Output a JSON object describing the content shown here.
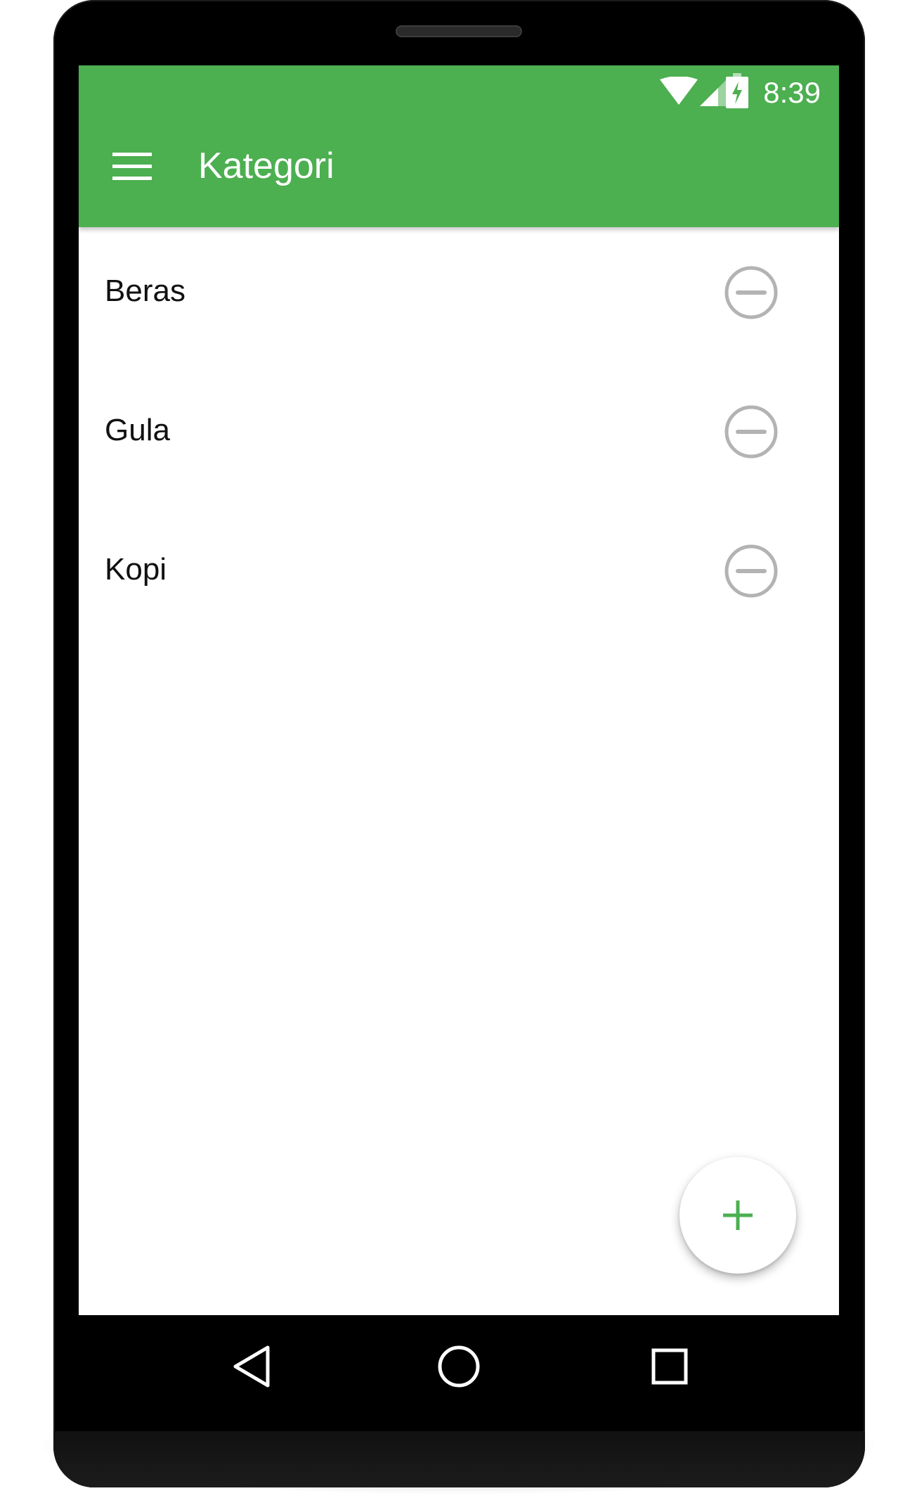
{
  "status_bar": {
    "time": "8:39",
    "icons": [
      "wifi-icon",
      "cell-signal-icon",
      "battery-charging-icon"
    ]
  },
  "app_bar": {
    "menu_icon": "hamburger-menu-icon",
    "title": "Kategori",
    "color": "#4caf50"
  },
  "categories": [
    {
      "label": "Beras",
      "action_icon": "remove-circle-icon"
    },
    {
      "label": "Gula",
      "action_icon": "remove-circle-icon"
    },
    {
      "label": "Kopi",
      "action_icon": "remove-circle-icon"
    }
  ],
  "fab": {
    "icon": "plus-icon",
    "accent": "#4caf50"
  },
  "nav_bar": {
    "icons": [
      "back-icon",
      "home-icon",
      "recents-icon"
    ]
  },
  "colors": {
    "remove_icon": "#b3b3b3",
    "text": "#111111"
  }
}
